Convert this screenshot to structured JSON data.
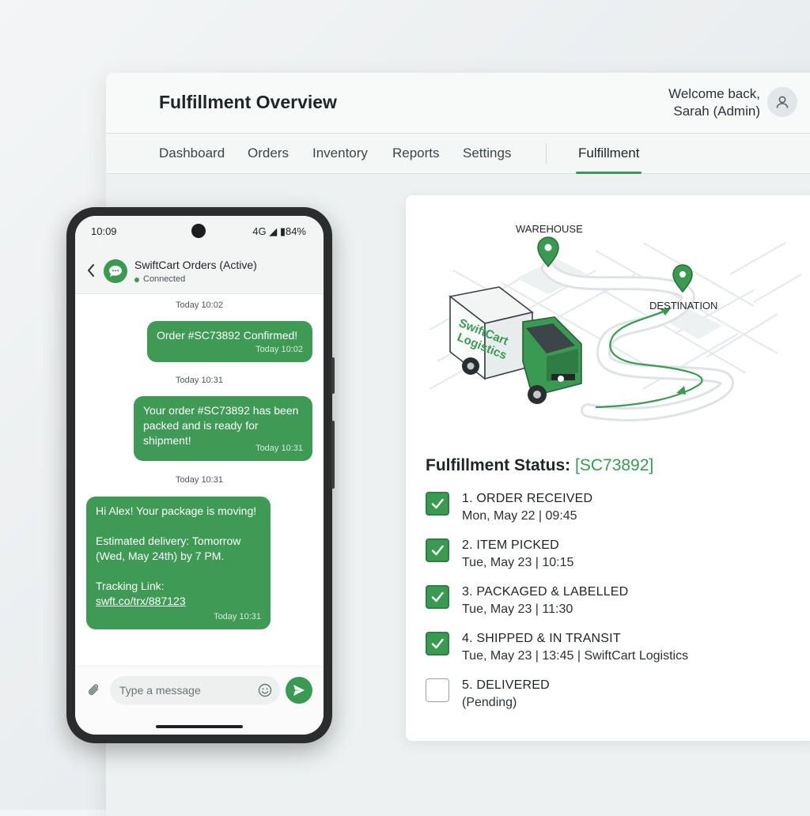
{
  "window": {
    "title": "Fulfillment Overview",
    "welcome_line1": "Welcome back,",
    "welcome_line2": "Sarah (Admin)",
    "nav": [
      "Dashboard",
      "Orders",
      "Inventory",
      "Reports",
      "Settings"
    ],
    "nav_active": "Fulfillment"
  },
  "map": {
    "origin_label": "WAREHOUSE",
    "destination_label": "DESTINATION",
    "truck_text_line1": "SwiftCart",
    "truck_text_line2": "Logistics"
  },
  "fulfillment": {
    "title": "Fulfillment Status:",
    "order_id": "[SC73892]",
    "steps": [
      {
        "title": "1. ORDER RECEIVED",
        "detail": "Mon, May 22 | 09:45",
        "done": true
      },
      {
        "title": "2. ITEM PICKED",
        "detail": " Tue, May 23 | 10:15",
        "done": true
      },
      {
        "title": "3. PACKAGED & LABELLED",
        "detail": " Tue, May 23 | 11:30",
        "done": true
      },
      {
        "title": "4. SHIPPED & IN TRANSIT",
        "detail": " Tue, May 23 | 13:45 | SwiftCart Logistics",
        "done": true
      },
      {
        "title": "5. DELIVERED",
        "detail": "(Pending)",
        "done": false
      }
    ]
  },
  "phone": {
    "time": "10:09",
    "signal": "4G ◢ ▮84%",
    "chat_title": "SwiftCart Orders (Active)",
    "chat_status": "Connected",
    "messages": [
      {
        "day": "Today 10:02",
        "lines": [
          "Order #SC73892 Confirmed!"
        ],
        "time": "Today 10:02"
      },
      {
        "day": "Today 10:31",
        "lines": [
          "Your order #SC73892 has been",
          "packed and is ready for",
          "shipment!"
        ],
        "time": "Today 10:31"
      },
      {
        "day": "Today 10:31",
        "lines": [
          "Hi Alex! Your package is moving!",
          "",
          "Estimated delivery: Tomorrow",
          "(Wed, May 24th) by 7 PM.",
          "",
          "Tracking Link:"
        ],
        "link": "swft.co/trx/887123",
        "time": "Today 10:31"
      }
    ],
    "input_placeholder": "Type a message"
  },
  "colors": {
    "accent": "#3a9a52",
    "bubble": "#3e9a55",
    "truck_green": "#3a9a52"
  }
}
